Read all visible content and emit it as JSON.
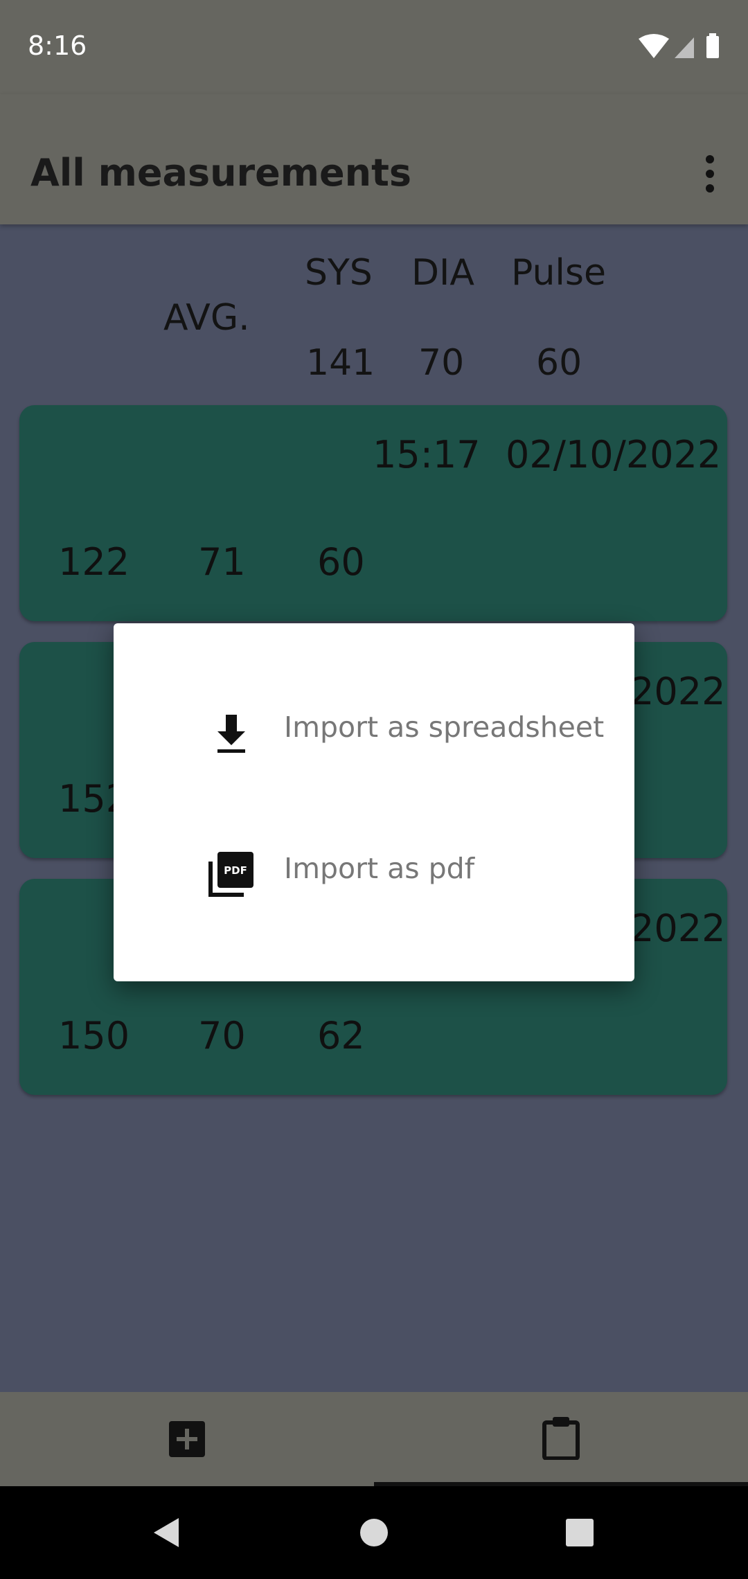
{
  "status_bar": {
    "time": "8:16",
    "icons": [
      "wifi-icon",
      "signal-icon",
      "battery-icon"
    ]
  },
  "app_bar": {
    "title": "All measurements",
    "menu_icon": "more-vert-icon"
  },
  "averages": {
    "label": "AVG.",
    "columns": [
      "SYS",
      "DIA",
      "Pulse"
    ],
    "values": [
      "141",
      "70",
      "60"
    ]
  },
  "measurements": [
    {
      "time": "15:17",
      "date": "02/10/2022",
      "sys": "122",
      "dia": "71",
      "pulse": "60"
    },
    {
      "date_partial": "2022",
      "sys_partial": "152"
    },
    {
      "date_partial": "2022",
      "sys": "150",
      "dia": "70",
      "pulse": "62"
    }
  ],
  "dialog": {
    "options": [
      {
        "label": "Import as spreadsheet",
        "icon": "download-icon"
      },
      {
        "label": "Import as pdf",
        "icon": "pdf-icon"
      }
    ]
  },
  "bottom_nav": {
    "items": [
      {
        "icon": "add-box-icon"
      },
      {
        "icon": "clipboard-icon"
      }
    ],
    "selected_index": 1
  },
  "system_nav": [
    "back-icon",
    "home-icon",
    "recents-icon"
  ],
  "colors": {
    "scrim_bar": "#666660",
    "background": "#4b5063",
    "card": "#1d5148",
    "dialog": "#ffffff",
    "dialog_text": "#777777"
  }
}
